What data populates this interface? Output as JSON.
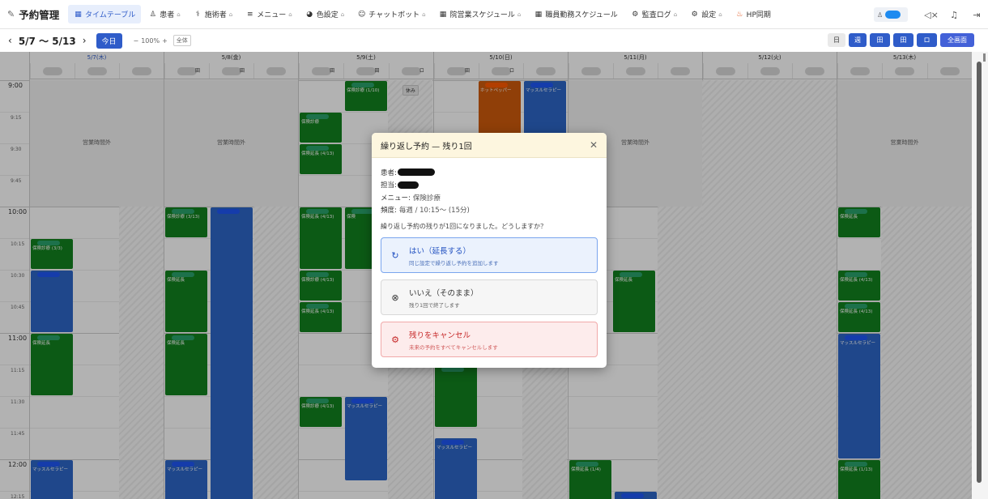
{
  "app": {
    "title": "予約管理"
  },
  "nav": [
    {
      "label": "タイムテーブル",
      "icon": "calendar-icon",
      "active": true,
      "locked": false
    },
    {
      "label": "患者",
      "icon": "person-icon",
      "active": false,
      "locked": true
    },
    {
      "label": "施術者",
      "icon": "stethoscope-icon",
      "active": false,
      "locked": true
    },
    {
      "label": "メニュー",
      "icon": "menu-list-icon",
      "active": false,
      "locked": true
    },
    {
      "label": "色設定",
      "icon": "palette-icon",
      "active": false,
      "locked": true
    },
    {
      "label": "チャットボット",
      "icon": "bot-icon",
      "active": false,
      "locked": true
    },
    {
      "label": "院営業スケジュール",
      "icon": "calendar-icon",
      "active": false,
      "locked": true
    },
    {
      "label": "職員勤務スケジュール",
      "icon": "calendar-icon",
      "active": false,
      "locked": false
    },
    {
      "label": "監査ログ",
      "icon": "gear-icon",
      "active": false,
      "locked": true
    },
    {
      "label": "設定",
      "icon": "gear-icon",
      "active": false,
      "locked": true
    },
    {
      "label": "HP同期",
      "icon": "flame-icon",
      "active": false,
      "locked": false
    }
  ],
  "toolbar": {
    "range": "5/7 〜 5/13",
    "today": "今日",
    "zoom": "100%",
    "fit": "全体",
    "views": [
      "日",
      "週",
      "田",
      "田",
      "ロ",
      "全画面"
    ]
  },
  "days": [
    {
      "label": "5/7(木)",
      "today": true,
      "subs": [
        "",
        "",
        ""
      ],
      "closed_label": "営業時間外"
    },
    {
      "label": "5/8(金)",
      "today": false,
      "subs": [
        "田",
        "田",
        ""
      ],
      "closed_label": "営業時間外"
    },
    {
      "label": "5/9(土)",
      "today": false,
      "subs": [
        "田",
        "田",
        "ロ"
      ],
      "closed_label": ""
    },
    {
      "label": "5/10(日)",
      "today": false,
      "subs": [
        "田",
        "ロ",
        ""
      ],
      "closed_label": ""
    },
    {
      "label": "5/11(月)",
      "today": false,
      "subs": [
        "",
        "",
        ""
      ],
      "closed_label": "営業時間外"
    },
    {
      "label": "5/12(火)",
      "today": false,
      "subs": [
        "",
        "",
        ""
      ],
      "closed_label": ""
    },
    {
      "label": "5/13(木)",
      "today": false,
      "subs": [
        "",
        "",
        ""
      ],
      "closed_label": "営業時間外"
    }
  ],
  "times": [
    {
      "label": "9:00",
      "major": true
    },
    {
      "label": "9:15",
      "major": false
    },
    {
      "label": "9:30",
      "major": false
    },
    {
      "label": "9:45",
      "major": false
    },
    {
      "label": "10:00",
      "major": true
    },
    {
      "label": "10:15",
      "major": false
    },
    {
      "label": "10:30",
      "major": false
    },
    {
      "label": "10:45",
      "major": false
    },
    {
      "label": "11:00",
      "major": true
    },
    {
      "label": "11:15",
      "major": false
    },
    {
      "label": "11:30",
      "major": false
    },
    {
      "label": "11:45",
      "major": false
    },
    {
      "label": "12:00",
      "major": true
    },
    {
      "label": "12:15",
      "major": false
    }
  ],
  "appointments": [
    {
      "label": "保険診療 (3/3)",
      "color": "green"
    },
    {
      "label": "",
      "color": "blue"
    },
    {
      "label": "保険延長",
      "color": "green"
    },
    {
      "label": "マッスルセラピー",
      "color": "blue"
    },
    {
      "label": "保険診療 (3/13)",
      "color": "green"
    },
    {
      "label": "",
      "color": "blue"
    },
    {
      "label": "保険延長",
      "color": "green"
    },
    {
      "label": "保険延長",
      "color": "green"
    },
    {
      "label": "マッスルセラピー",
      "color": "blue"
    },
    {
      "label": "保険診療",
      "color": "green"
    },
    {
      "label": "保険延長 (4/13)",
      "color": "green"
    },
    {
      "label": "保険延長 (4/13)",
      "color": "green"
    },
    {
      "label": "保険診療 (4/13)",
      "color": "green"
    },
    {
      "label": "保険延長 (4/13)",
      "color": "green"
    },
    {
      "label": "保険診療 (4/13)",
      "color": "green"
    },
    {
      "label": "保険診療 (1/10)",
      "color": "green"
    },
    {
      "label": "保険",
      "color": "green"
    },
    {
      "label": "マッスルセラピー",
      "color": "blue"
    },
    {
      "label": "ホットペッパー",
      "color": "orange"
    },
    {
      "label": "マッスルセラピー",
      "color": "blue"
    },
    {
      "label": "",
      "color": "green"
    },
    {
      "label": "マッスルセラピー",
      "color": "blue"
    },
    {
      "label": "保険延長",
      "color": "green"
    },
    {
      "label": "保険延長 (1/4)",
      "color": "green"
    },
    {
      "label": "",
      "color": "blue"
    },
    {
      "label": "保険延長",
      "color": "green"
    },
    {
      "label": "保険延長 (4/13)",
      "color": "green"
    },
    {
      "label": "保険延長 (4/13)",
      "color": "green"
    },
    {
      "label": "マッスルセラピー",
      "color": "blue"
    },
    {
      "label": "保険延長 (1/13)",
      "color": "green"
    }
  ],
  "rest_label": "休み",
  "modal": {
    "title": "繰り返し予約 — 残り1回",
    "patient_key": "患者:",
    "staff_key": "担当:",
    "menu_key": "メニュー:",
    "menu_value": "保険診療",
    "freq_key": "頻度:",
    "freq_value": "毎週 / 10:15〜 (15分)",
    "question": "繰り返し予約の残りが1回になりました。どうしますか？",
    "options": [
      {
        "title": "はい（延長する）",
        "sub": "同じ設定で繰り返し予約を追加します",
        "icon": "refresh-icon"
      },
      {
        "title": "いいえ（そのまま）",
        "sub": "残り1回で終了します",
        "icon": "x-circle-icon"
      },
      {
        "title": "残りをキャンセル",
        "sub": "未来の予約をすべてキャンセルします",
        "icon": "gear-icon"
      }
    ]
  }
}
